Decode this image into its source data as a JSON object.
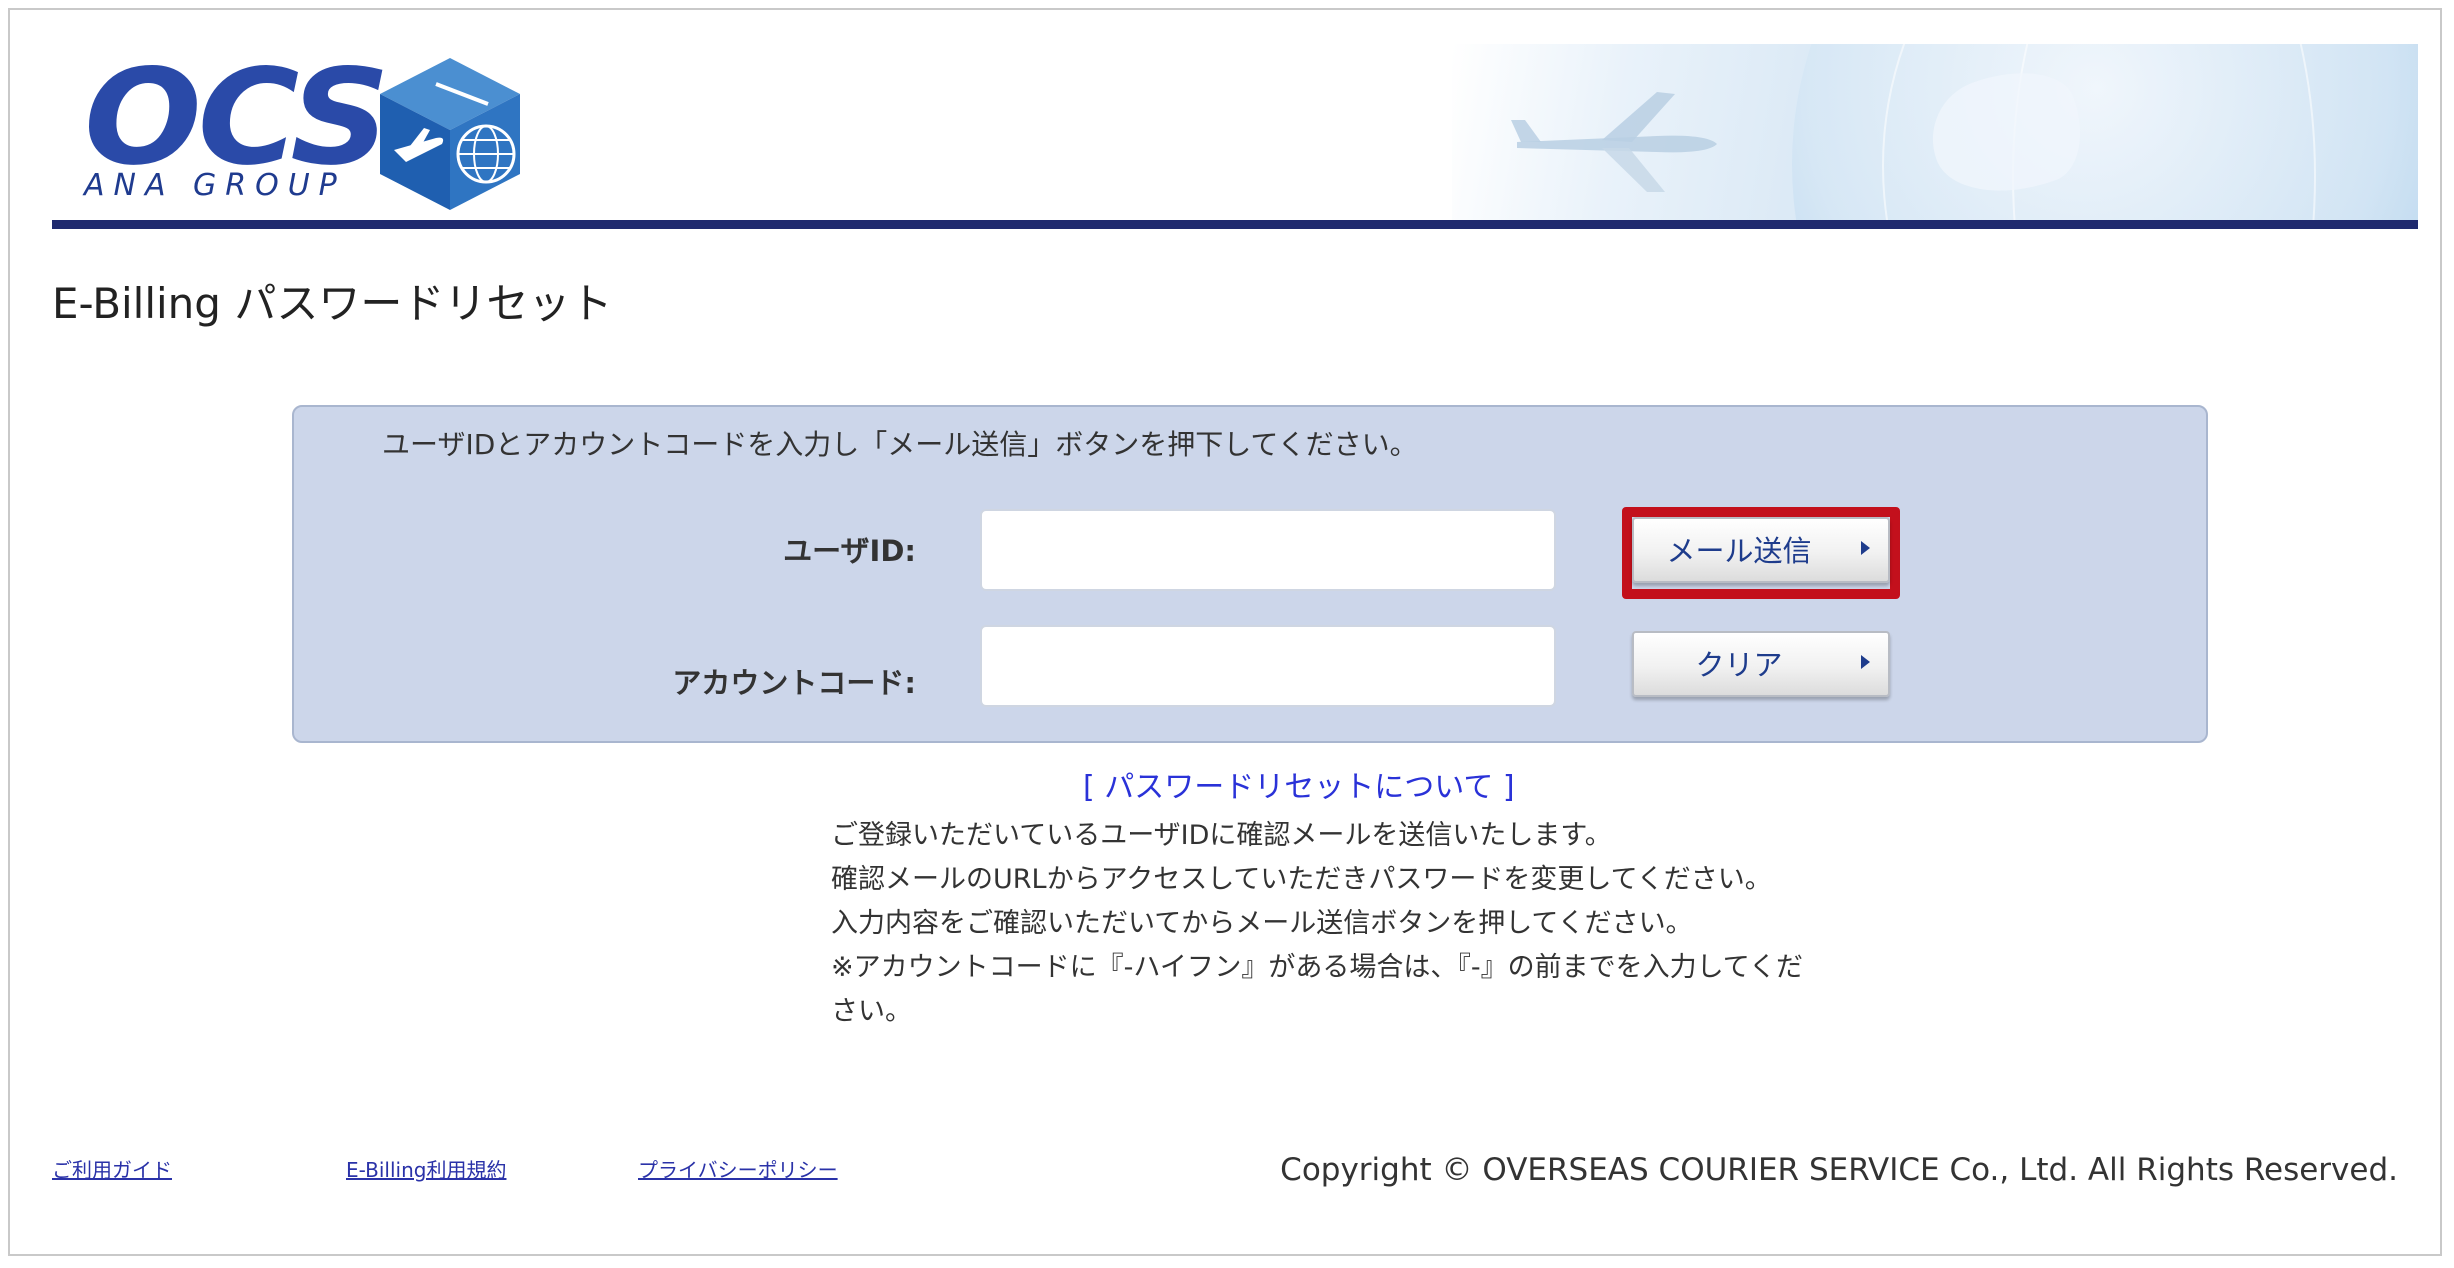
{
  "header": {
    "logo": {
      "brand": "OCS",
      "sub": "ANA GROUP"
    }
  },
  "page": {
    "title": "E-Billing パスワードリセット"
  },
  "form": {
    "instruction": "ユーザIDとアカウントコードを入力し「メール送信」ボタンを押下してください。",
    "user_id": {
      "label": "ユーザID:",
      "value": ""
    },
    "account_code": {
      "label": "アカウントコード:",
      "value": ""
    },
    "send_button_label": "メール送信",
    "clear_button_label": "クリア"
  },
  "info": {
    "link_label": "[ パスワードリセットについて ]",
    "lines": [
      "ご登録いただいているユーザIDに確認メールを送信いたします。",
      "確認メールのURLからアクセスしていただきパスワードを変更してください。",
      "入力内容をご確認いただいてからメール送信ボタンを押してください。",
      "※アカウントコードに『-ハイフン』がある場合は、『-』の前までを入力してくだ",
      "さい。"
    ]
  },
  "footer": {
    "links": [
      "ご利用ガイド",
      "E-Billing利用規約",
      "プライバシーポリシー"
    ],
    "copyright": "Copyright © OVERSEAS COURIER SERVICE Co., Ltd. All Rights Reserved."
  },
  "colors": {
    "brand_blue": "#2a4aa8",
    "header_rule": "#1f2a6e",
    "panel_bg": "#ccd6ea",
    "highlight_red": "#c3101c",
    "link_blue": "#2a32d8"
  }
}
